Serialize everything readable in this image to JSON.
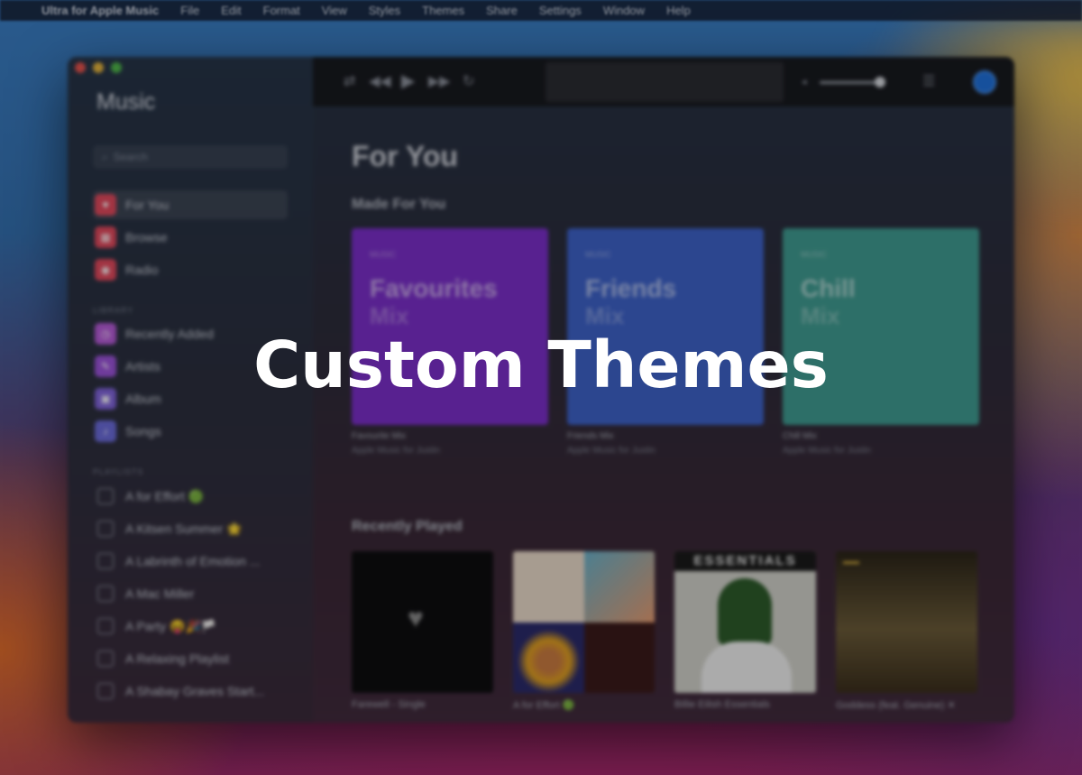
{
  "menubar": {
    "apple_glyph": "",
    "app_name": "Ultra for Apple Music",
    "items": [
      "File",
      "Edit",
      "Format",
      "View",
      "Styles",
      "Themes",
      "Share",
      "Settings",
      "Window",
      "Help"
    ]
  },
  "sidebar": {
    "logo_glyph": "",
    "logo_text": "Music",
    "search_placeholder": "Search",
    "nav": [
      {
        "label": "For You",
        "icon": "heart-icon",
        "color": "#e0485c"
      },
      {
        "label": "Browse",
        "icon": "grid-icon",
        "color": "#e0485c"
      },
      {
        "label": "Radio",
        "icon": "radio-icon",
        "color": "#e0485c"
      }
    ],
    "library_label": "LIBRARY",
    "library": [
      {
        "label": "Recently Added",
        "icon": "clock-icon",
        "color": "#b45ad6"
      },
      {
        "label": "Artists",
        "icon": "mic-icon",
        "color": "#9a52d8"
      },
      {
        "label": "Album",
        "icon": "album-icon",
        "color": "#7e62d8"
      },
      {
        "label": "Songs",
        "icon": "note-icon",
        "color": "#6a6ad8"
      }
    ],
    "playlists_label": "PLAYLISTS",
    "playlists": [
      "A for Effort 🟢",
      "A Kitsen Summer 🌟",
      "A Labrinth of Emotion ...",
      "A Mac Miller",
      "A Party 😝🎉🏳️",
      "A Relaxing Playlist",
      "A Shabay Graves Start..."
    ]
  },
  "player": {
    "shuffle": "⇄",
    "prev": "◀◀",
    "play": "▶",
    "next": "▶▶",
    "repeat": "↻",
    "lcd_glyph": "",
    "volume": 0.85
  },
  "main": {
    "title": "For You",
    "made_for_you": "Made For You",
    "mixes": [
      {
        "brand": " MUSIC",
        "name": "Favourites",
        "sub": "Mix",
        "color": "#7a2fc8",
        "caption": "Favourite Mix",
        "caption_sub": "Apple Music for Justin"
      },
      {
        "brand": " MUSIC",
        "name": "Friends",
        "sub": "Mix",
        "color": "#3d61c7",
        "caption": "Friends Mix",
        "caption_sub": "Apple Music for Justin"
      },
      {
        "brand": " MUSIC",
        "name": "Chill",
        "sub": "Mix",
        "color": "#3f9a90",
        "caption": "Chill Mix",
        "caption_sub": "Apple Music for Justin"
      }
    ],
    "recently_played": "Recently Played",
    "recent": [
      {
        "caption": "Farewell - Single"
      },
      {
        "caption": "A for Effort 🟢"
      },
      {
        "caption": "Billie Eilish Essentials"
      },
      {
        "caption": "Goddess (feat. Genuine) ✕"
      }
    ],
    "essentials_text": "ESSENTIALS"
  },
  "overlay": {
    "headline": "Custom Themes"
  }
}
